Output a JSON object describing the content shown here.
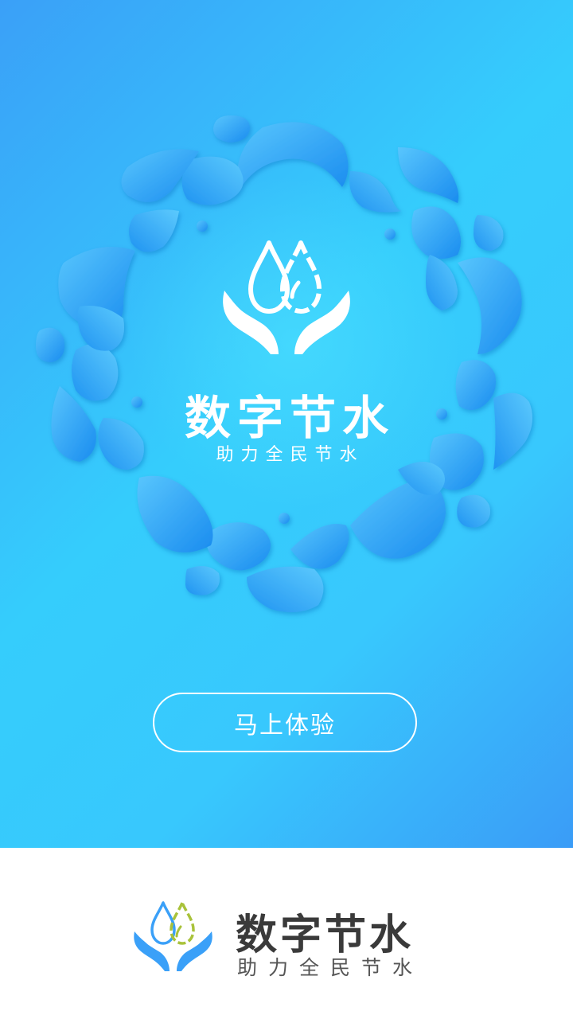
{
  "hero": {
    "title": "数字节水",
    "subtitle": "助力全民节水",
    "icon": "water-drops-hands-icon"
  },
  "cta": {
    "label": "马上体验"
  },
  "footer": {
    "title": "数字节水",
    "subtitle": "助力全民节水",
    "icon": "water-drops-hands-icon"
  },
  "colors": {
    "gradient_start": "#3aa0f8",
    "gradient_mid": "#35cdfc",
    "drop_light": "#4ab8fb",
    "drop_dark": "#1c8ff0",
    "footer_drop_blue": "#3aa0f8",
    "footer_drop_green": "#a9c23a",
    "footer_text": "#3a3a3a"
  }
}
